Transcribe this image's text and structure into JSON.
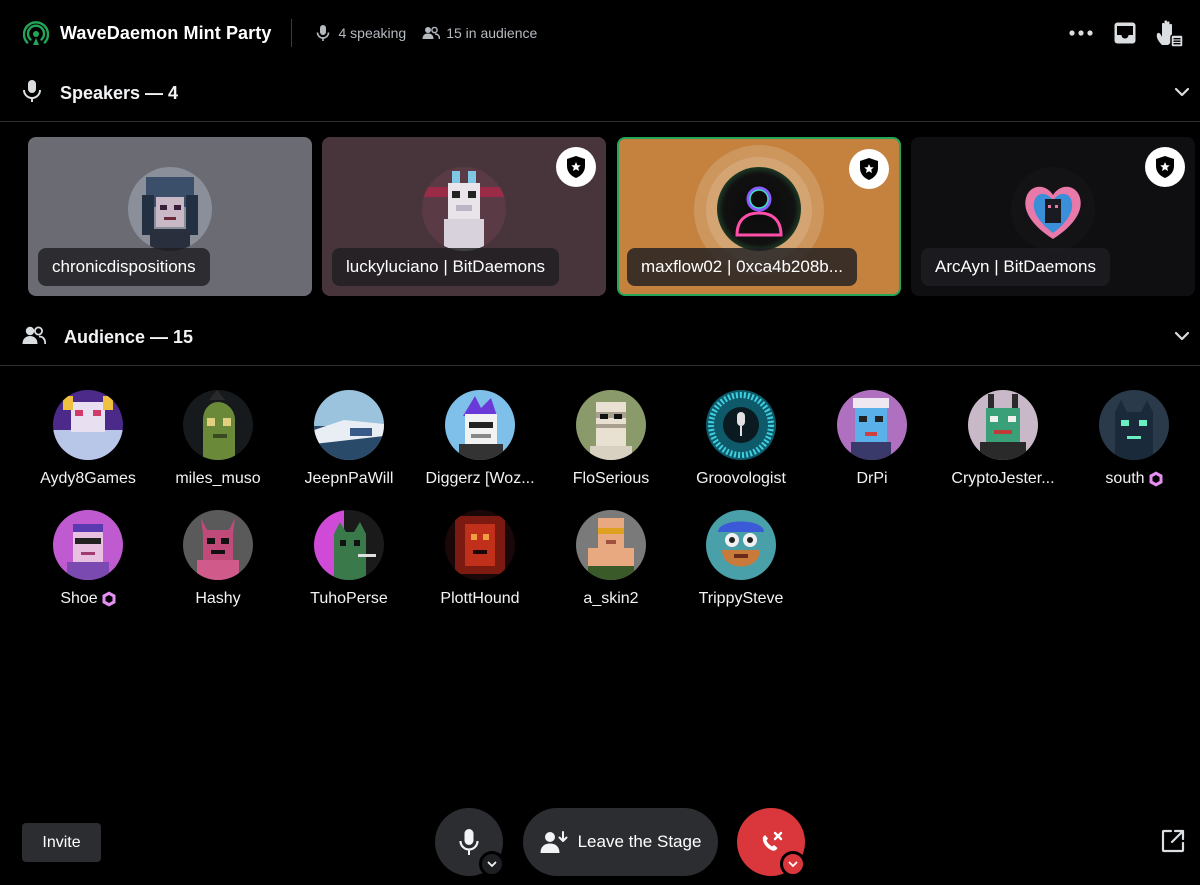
{
  "header": {
    "title": "WaveDaemon Mint Party",
    "speaking": "4 speaking",
    "audience": "15 in audience",
    "actions": [
      "more-icon",
      "inbox-icon",
      "raise-hand-icon"
    ]
  },
  "speakers": {
    "title": "Speakers — 4",
    "items": [
      {
        "name": "chronicdispositions",
        "moderator": false,
        "bg": "#6b6b74"
      },
      {
        "name": "luckyluciano | BitDaemons",
        "moderator": true,
        "bg": "#47353b"
      },
      {
        "name": "maxflow02 | 0xca4b208b...",
        "moderator": true,
        "bg": "#c4823e",
        "speaking": true
      },
      {
        "name": "ArcAyn | BitDaemons",
        "moderator": true,
        "bg": "#0f0f11"
      }
    ]
  },
  "audience": {
    "title": "Audience — 15",
    "items": [
      {
        "name": "Aydy8Games"
      },
      {
        "name": "miles_muso"
      },
      {
        "name": "JeepnPaWill"
      },
      {
        "name": "Diggerz [Woz..."
      },
      {
        "name": "FloSerious"
      },
      {
        "name": "Groovologist"
      },
      {
        "name": "DrPi"
      },
      {
        "name": "CryptoJester..."
      },
      {
        "name": "south",
        "nitro": true
      },
      {
        "name": "Shoe",
        "nitro": true
      },
      {
        "name": "Hashy"
      },
      {
        "name": "TuhoPerse"
      },
      {
        "name": "PlottHound"
      },
      {
        "name": "a_skin2"
      },
      {
        "name": "TrippySteve"
      }
    ]
  },
  "controls": {
    "invite": "Invite",
    "leave": "Leave the Stage"
  },
  "colors": {
    "accent_green": "#23a55a",
    "danger": "#da373c",
    "nitro": "#e58ff0"
  }
}
